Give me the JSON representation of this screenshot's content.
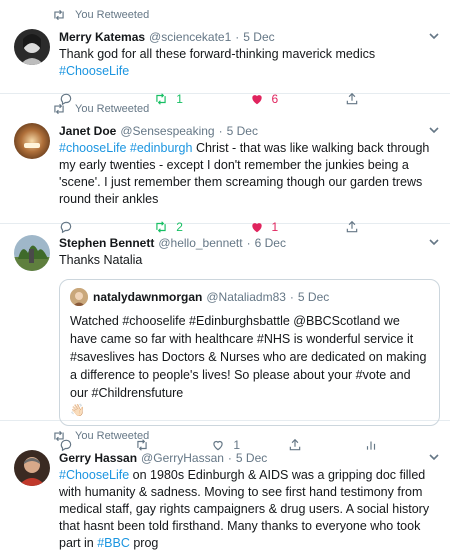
{
  "tweets": [
    {
      "retweet_label": "You Retweeted",
      "name": "Merry Katemas",
      "handle": "@sciencekate1",
      "date": "5 Dec",
      "text_plain": "Thank god for all these forward-thinking maverick medics ",
      "text_tag": "#ChooseLife",
      "retweets": "1",
      "likes": "6"
    },
    {
      "retweet_label": "You Retweeted",
      "name": "Janet Doe",
      "handle": "@Sensespeaking",
      "date": "5 Dec",
      "tag1": "#chooseLife",
      "tag2": "#edinburgh",
      "text_rest": " Christ - that was like walking back through my early twenties - except I don't remember the junkies being a 'scene'. I just remember them screaming though our garden trews round their ankles",
      "retweets": "2",
      "likes": "1"
    },
    {
      "name": "Stephen Bennett",
      "handle": "@hello_bennett",
      "date": "6 Dec",
      "text": "Thanks Natalia",
      "quote": {
        "name": "natalydawnmorgan",
        "handle": "@Nataliadm83",
        "date": "5 Dec",
        "text": "Watched #chooselife #Edinburghsbattle @BBCScotland we have came so far with healthcare #NHS is wonderful service it #saveslives has Doctors & Nurses who are dedicated on making a difference to people's lives! So please about your #vote and our #Childrensfuture",
        "emoji": "👋🏻"
      },
      "likes": "1"
    },
    {
      "retweet_label": "You Retweeted",
      "name": "Gerry Hassan",
      "handle": "@GerryHassan",
      "date": "5 Dec",
      "tag1": "#ChooseLife",
      "text_mid": " on 1980s Edinburgh & AIDS was a gripping doc filled with humanity & sadness. Moving to see first hand testimony from medical staff, gay rights campaigners & drug users. A social history that hasnt been told firsthand. Many thanks to everyone who took part in ",
      "tag2": "#BBC",
      "text_end": " prog"
    }
  ]
}
